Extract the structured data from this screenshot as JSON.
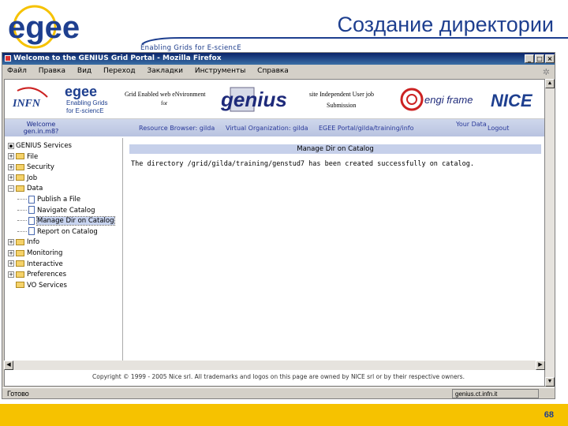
{
  "slide": {
    "title": "Создание директории",
    "tagline": "Enabling Grids for E-sciencE",
    "logo_text": "egee",
    "page_number": "68"
  },
  "browser": {
    "title": "Welcome to the GENIUS Grid Portal - Mozilla Firefox",
    "menu": [
      "Файл",
      "Правка",
      "Вид",
      "Переход",
      "Закладки",
      "Инструменты",
      "Справка"
    ],
    "status": "Готово",
    "status_host": "genius.ct.infn.it"
  },
  "banner": {
    "infn": "INFN",
    "egee_line1": "Enabling Grids",
    "egee_line2": "for E-sciencE",
    "gene_text": "Grid Enabled web eNvironment",
    "gene_sub": "for",
    "genius": "genius",
    "piu_text": "site Independent User job",
    "piu_sub": "Submission",
    "engframe": "engi frame",
    "nice": "NICE"
  },
  "nav": {
    "welcome": "Welcome gen.in.m8?",
    "links": [
      "Resource Browser: gilda",
      "Virtual Organization: gilda",
      "EGEE Portal/gilda/training/info"
    ],
    "date": "Your Data",
    "logout": "Logout"
  },
  "tree": [
    {
      "label": "GENIUS Services",
      "level": 0,
      "kind": "root"
    },
    {
      "label": "File",
      "level": 0,
      "kind": "folder",
      "sign": "+"
    },
    {
      "label": "Security",
      "level": 0,
      "kind": "folder",
      "sign": "+"
    },
    {
      "label": "Job",
      "level": 0,
      "kind": "folder",
      "sign": "+"
    },
    {
      "label": "Data",
      "level": 0,
      "kind": "folder-open",
      "sign": "−"
    },
    {
      "label": "Publish a File",
      "level": 1,
      "kind": "doc"
    },
    {
      "label": "Navigate Catalog",
      "level": 1,
      "kind": "doc"
    },
    {
      "label": "Manage Dir on Catalog",
      "level": 1,
      "kind": "doc",
      "selected": true
    },
    {
      "label": "Report on Catalog",
      "level": 1,
      "kind": "doc"
    },
    {
      "label": "Info",
      "level": 0,
      "kind": "folder",
      "sign": "+"
    },
    {
      "label": "Monitoring",
      "level": 0,
      "kind": "folder",
      "sign": "+"
    },
    {
      "label": "Interactive",
      "level": 0,
      "kind": "folder",
      "sign": "+"
    },
    {
      "label": "Preferences",
      "level": 0,
      "kind": "folder",
      "sign": "+"
    },
    {
      "label": "VO Services",
      "level": 0,
      "kind": "folder"
    }
  ],
  "content": {
    "header": "Manage Dir on Catalog",
    "message": "The directory /grid/gilda/training/genstud7 has been created successfully on catalog."
  },
  "copyright": "Copyright © 1999 - 2005 Nice srl. All trademarks and logos on this page are owned by NICE srl or by their respective owners."
}
